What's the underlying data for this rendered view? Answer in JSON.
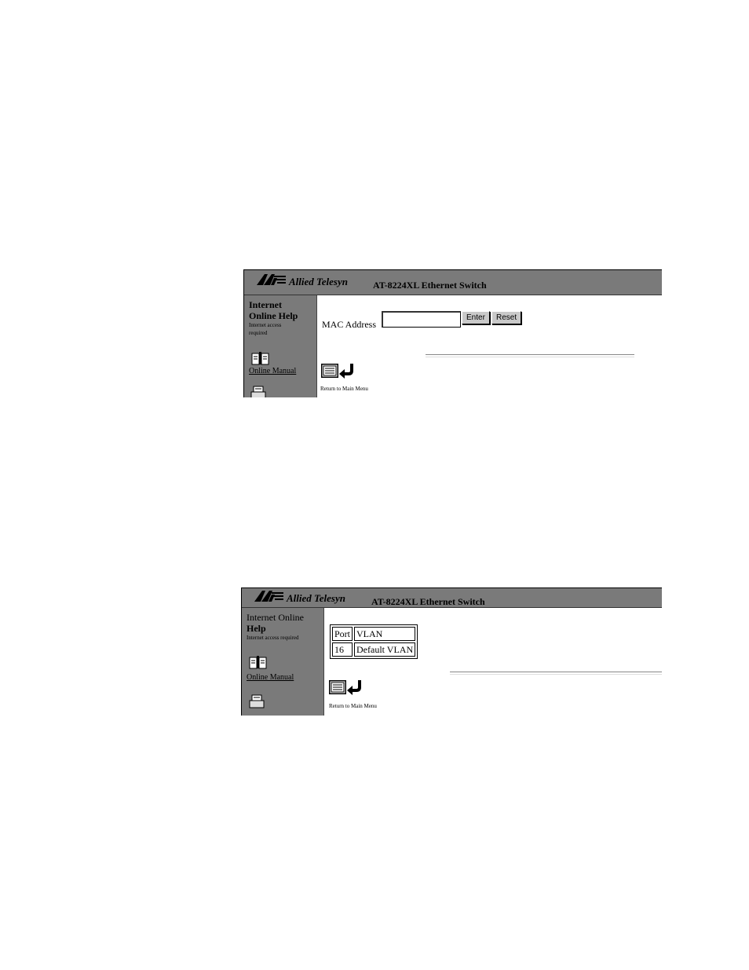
{
  "screen1": {
    "brand": "Allied Telesyn",
    "title": "AT-8224XL Ethernet Switch",
    "help_line1": "Internet",
    "help_line2": "Online Help",
    "help_note_line1": "Internet access",
    "help_note_line2": "required",
    "manual_link": "Online Manual",
    "mac_label": "MAC Address",
    "mac_value": "",
    "enter_label": "Enter",
    "reset_label": "Reset",
    "return_label": "Return to Main Menu"
  },
  "screen2": {
    "brand": "Allied Telesyn",
    "title": "AT-8224XL Ethernet Switch",
    "help_line1": "Internet Online",
    "help_line2": "Help",
    "help_note": "Internet access required",
    "manual_link": "Online Manual",
    "table": {
      "headers": [
        "Port",
        "VLAN"
      ],
      "rows": [
        [
          "16",
          "Default VLAN"
        ]
      ]
    },
    "return_label": "Return to Main Menu"
  },
  "icons": [
    "at-logo-icon",
    "book-icon",
    "printer-icon",
    "menu-list-icon",
    "return-arrow-icon"
  ]
}
